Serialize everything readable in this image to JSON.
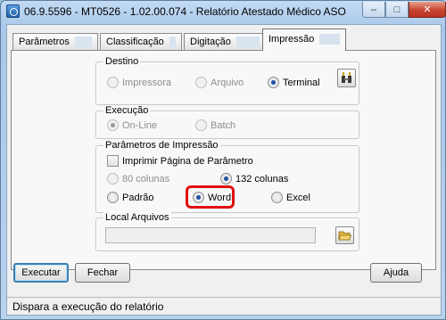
{
  "window": {
    "title": "06.9.5596 - MT0526 - 1.02.00.074 - Relatório Atestado Médico ASO",
    "minimize_glyph": "–",
    "maximize_glyph": "□",
    "close_glyph": "✕"
  },
  "tabs": [
    {
      "label": "Parâmetros",
      "active": false
    },
    {
      "label": "Classificação",
      "active": false
    },
    {
      "label": "Digitação",
      "active": false
    },
    {
      "label": "Impressão",
      "active": true
    }
  ],
  "destino": {
    "legend": "Destino",
    "options": [
      {
        "label": "Impressora",
        "checked": false,
        "enabled": false
      },
      {
        "label": "Arquivo",
        "checked": false,
        "enabled": false
      },
      {
        "label": "Terminal",
        "checked": true,
        "enabled": true
      }
    ],
    "config_icon": "printer-settings-icon"
  },
  "execucao": {
    "legend": "Execução",
    "options": [
      {
        "label": "On-Line",
        "checked": true,
        "enabled": false
      },
      {
        "label": "Batch",
        "checked": false,
        "enabled": false
      }
    ]
  },
  "parametros_impressao": {
    "legend": "Parâmetros de Impressão",
    "print_param_page_label": "Imprimir Página de Parâmetro",
    "print_param_page_checked": false,
    "columns": [
      {
        "label": "80 colunas",
        "checked": false,
        "enabled": false
      },
      {
        "label": "132 colunas",
        "checked": true,
        "enabled": true
      }
    ],
    "format": [
      {
        "label": "Padrão",
        "checked": false,
        "enabled": true
      },
      {
        "label": "Word",
        "checked": true,
        "enabled": true
      },
      {
        "label": "Excel",
        "checked": false,
        "enabled": true
      }
    ],
    "highlight_color": "#e01010"
  },
  "local_arquivos": {
    "legend": "Local Arquivos",
    "value": "",
    "browse_icon": "folder-open-icon"
  },
  "buttons": {
    "executar": "Executar",
    "fechar": "Fechar",
    "ajuda": "Ajuda"
  },
  "status": {
    "text": "Dispara a execução do relatório"
  }
}
